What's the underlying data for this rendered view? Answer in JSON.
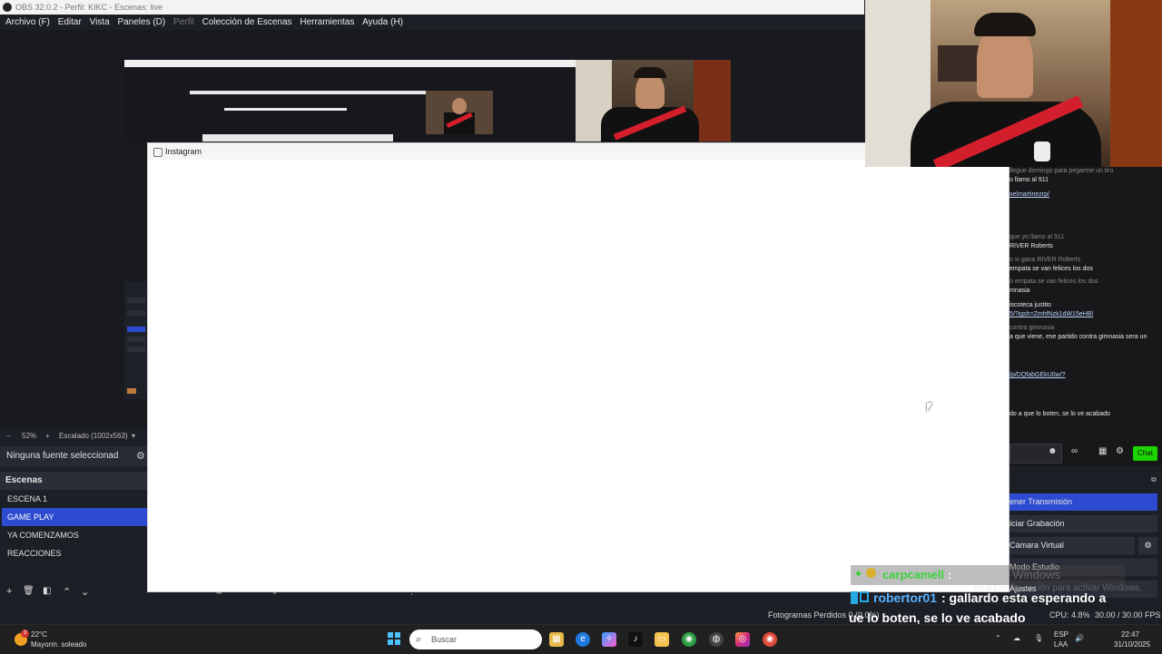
{
  "title_bar": {
    "text": "OBS 32.0.2 - Perfil: KIKC - Escenas: live"
  },
  "menu": [
    {
      "label": "Archivo (F)",
      "disabled": false
    },
    {
      "label": "Editar",
      "disabled": false
    },
    {
      "label": "Vista",
      "disabled": false
    },
    {
      "label": "Paneles (D)",
      "disabled": false
    },
    {
      "label": "Perfil",
      "disabled": true
    },
    {
      "label": "Colección de Escenas",
      "disabled": false
    },
    {
      "label": "Herramientas",
      "disabled": false
    },
    {
      "label": "Ayuda (H)",
      "disabled": false
    }
  ],
  "preview": {
    "zoom": "52%",
    "scale_label": "Escalado (1002x563)",
    "minus": "−",
    "plus": "+"
  },
  "instagram_window": {
    "title": "Instagram"
  },
  "sources": {
    "none_selected": "Ninguna fuente seleccionad"
  },
  "scenes": {
    "header": "Escenas",
    "items": [
      {
        "label": "ESCENA 1",
        "active": false
      },
      {
        "label": "GAME PLAY",
        "active": true
      },
      {
        "label": "YA COMENZAMOS",
        "active": false
      },
      {
        "label": "REACCIONES",
        "active": false
      }
    ]
  },
  "chat": {
    "lines": [
      {
        "text": "llegue domingo para pegarme un tiro",
        "style": "faded"
      },
      {
        "text": "o llamo al 911",
        "style": "white"
      },
      {
        "text": "xelmartinezrp/",
        "style": "link"
      },
      {
        "text": "que yo llamo al 911",
        "style": "faded"
      },
      {
        "text": "RIVER Roberts",
        "style": "white"
      },
      {
        "text": "o si gana RIVER Roberts",
        "style": "faded"
      },
      {
        "text": "empata se van felices los dos",
        "style": "white"
      },
      {
        "text": "o empata se van felices los dos",
        "style": "faded"
      },
      {
        "text": "mnasia",
        "style": "white"
      },
      {
        "text": "iscoteca justito",
        "style": "white"
      },
      {
        "text": "5/?igsh=ZmhfNzk1dW15eHBl",
        "style": "link"
      },
      {
        "text": "contra gimnasia",
        "style": "faded"
      },
      {
        "text": "a que viene, ese partido contra gimnasia sera un",
        "style": "white"
      },
      {
        "text": "/p/DQfabGEkU0w/?",
        "style": "link"
      },
      {
        "text": "do a que lo boten, se lo ve acabado",
        "style": "white"
      }
    ],
    "chat_button": "Chat"
  },
  "controls": {
    "items": [
      {
        "label": "ener Transmisión",
        "active": true
      },
      {
        "label": "iciar Grabación",
        "active": false
      },
      {
        "label": "Cámara Virtual",
        "active": false
      },
      {
        "label": "Modo Estudio",
        "active": false
      },
      {
        "label": "Ajustes",
        "active": false
      }
    ]
  },
  "status": {
    "dropped": "Fotogramas Perdidos 0 (0.0%)",
    "cpu": "CPU: 4.8%",
    "fps": "30.00 / 30.00 FPS"
  },
  "overlay": {
    "msg1_user": "carpcamell",
    "msg1_sep": ":",
    "msg2_user": "robertor01",
    "msg2_text": ": gallardo esta esperando a",
    "msg2_cont": "ue lo boten, se lo ve acabado",
    "activate_1": "Activar Windows",
    "activate_2": "Ve a Configuración para activar Windows."
  },
  "taskbar": {
    "temp": "22°C",
    "weather": "Mayorm. soleado",
    "search_placeholder": "Buscar",
    "lang1": "ESP",
    "lang2": "LAA",
    "time": "22:47",
    "date": "31/10/2025",
    "badge": "3"
  }
}
